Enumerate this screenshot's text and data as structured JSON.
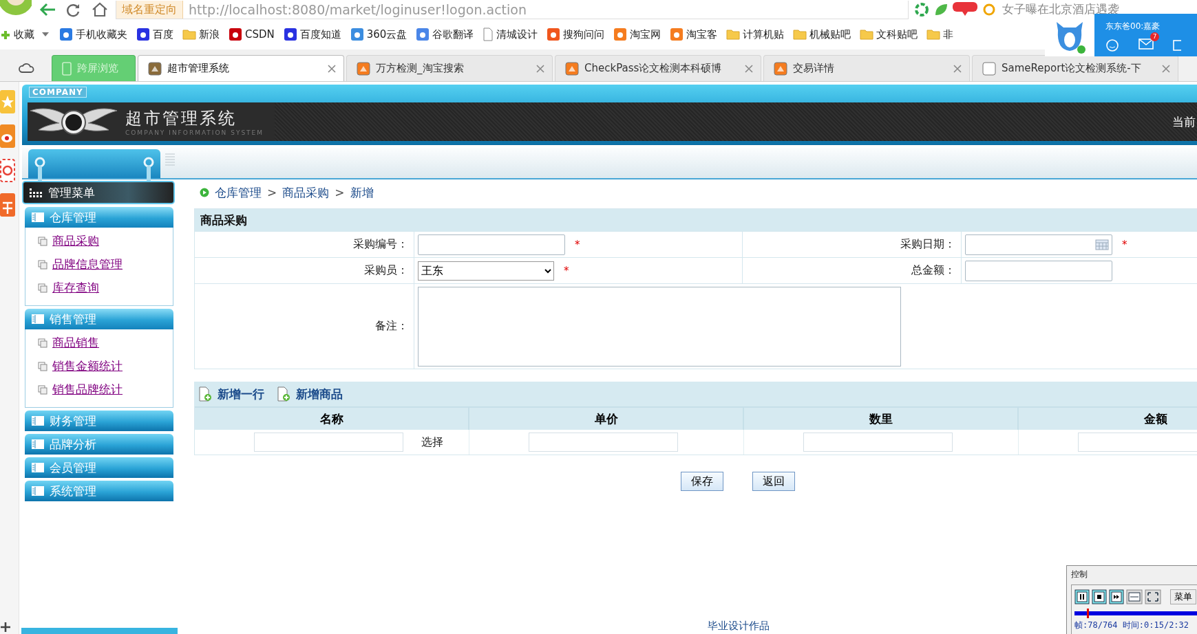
{
  "browser": {
    "address_badge": "域名重定向",
    "url": "http://localhost:8080/market/loginuser!logon.action",
    "headline": "女子曝在北京酒店遇袭",
    "bookmarks": [
      {
        "label": "收藏",
        "kind": "menu"
      },
      {
        "label": "手机收藏夹",
        "kind": "site",
        "color": "#2a7ae2"
      },
      {
        "label": "百度",
        "kind": "site",
        "color": "#2932e1"
      },
      {
        "label": "新浪",
        "kind": "folder"
      },
      {
        "label": "CSDN",
        "kind": "site",
        "color": "#c8000b"
      },
      {
        "label": "百度知道",
        "kind": "site",
        "color": "#2932e1"
      },
      {
        "label": "360云盘",
        "kind": "site",
        "color": "#3b8de0"
      },
      {
        "label": "谷歌翻译",
        "kind": "site",
        "color": "#4a86e8"
      },
      {
        "label": "清城设计",
        "kind": "page"
      },
      {
        "label": "搜狗问问",
        "kind": "site",
        "color": "#f0561d"
      },
      {
        "label": "淘宝网",
        "kind": "site",
        "color": "#f57c1f"
      },
      {
        "label": "淘宝客",
        "kind": "site",
        "color": "#f57c1f"
      },
      {
        "label": "计算机贴",
        "kind": "folder"
      },
      {
        "label": "机械贴吧",
        "kind": "folder"
      },
      {
        "label": "文科贴吧",
        "kind": "folder"
      },
      {
        "label": "非",
        "kind": "folder"
      }
    ],
    "tabs": [
      {
        "label": "跨屏浏览",
        "kind": "button",
        "selected": false
      },
      {
        "label": "超市管理系统",
        "kind": "page",
        "color": "#8a6b3a",
        "selected": true
      },
      {
        "label": "万方检测_淘宝搜索",
        "kind": "page",
        "color": "#f57c1f",
        "selected": false
      },
      {
        "label": "CheckPass论文检测本科硕博",
        "kind": "page",
        "color": "#f57c1f",
        "selected": false
      },
      {
        "label": "交易详情",
        "kind": "page",
        "color": "#f57c1f",
        "selected": false
      },
      {
        "label": "SameReport论文检测系统-下",
        "kind": "page",
        "color": "#ffffff",
        "selected": false
      }
    ],
    "notification": {
      "name": "东东爸00:嘉豪",
      "badge": "7"
    }
  },
  "app": {
    "header": {
      "badge": "COMPANY",
      "title": "超市管理系统",
      "subtitle": "COMPANY INFORMATION SYSTEM",
      "user_cut": "当前"
    },
    "sidebar": {
      "title": "管理菜单",
      "groups": [
        {
          "label": "仓库管理",
          "expanded": true,
          "items": [
            "商品采购",
            "品牌信息管理",
            "库存查询"
          ]
        },
        {
          "label": "销售管理",
          "expanded": true,
          "items": [
            "商品销售",
            "销售金额统计",
            "销售品牌统计"
          ]
        },
        {
          "label": "财务管理",
          "expanded": false
        },
        {
          "label": "品牌分析",
          "expanded": false
        },
        {
          "label": "会员管理",
          "expanded": false
        },
        {
          "label": "系统管理",
          "expanded": false
        }
      ]
    },
    "breadcrumb": [
      {
        "label": "仓库管理"
      },
      {
        "separator": ">",
        "label": "商品采购"
      },
      {
        "separator": ">",
        "label": "新增"
      }
    ],
    "form": {
      "title": "商品采购",
      "fields": [
        {
          "label": "采购编号：",
          "kind": "text",
          "required_mark": "*"
        },
        {
          "label": "采购日期：",
          "kind": "date",
          "required_mark": "*"
        },
        {
          "label": "采购员：",
          "kind": "select",
          "value": "王东",
          "required_mark": "*"
        },
        {
          "label": "总金额：",
          "kind": "text"
        },
        {
          "label": "备注：",
          "kind": "textarea"
        }
      ]
    },
    "toolbar": [
      "新增一行",
      "新增商品"
    ],
    "table": {
      "columns": [
        "名称",
        "单价",
        "数里",
        "金额"
      ],
      "rows": [
        {
          "cells": [
            {
              "kind": "input",
              "action": "选择"
            },
            {
              "kind": "input"
            },
            {
              "kind": "input"
            },
            {
              "kind": "input"
            }
          ]
        }
      ]
    },
    "actions": [
      "保存",
      "返回"
    ],
    "footer": "毕业设计作品"
  },
  "player": {
    "title": "控制",
    "menu": "菜单",
    "level": 0.1,
    "status": "帧:78/764 时间:0:15/2:32"
  }
}
